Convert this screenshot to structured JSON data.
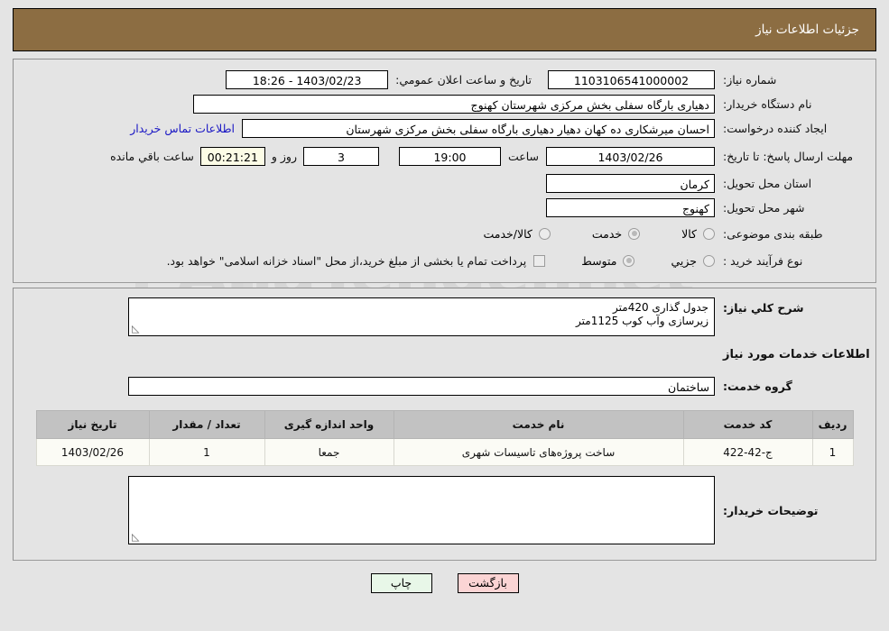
{
  "header": {
    "title": "جزئیات اطلاعات نیاز"
  },
  "colors": {
    "header_bg": "#8c6d42",
    "page_bg": "#e4e4e4",
    "link": "#1a17c4",
    "countdown_bg": "#fcfce6",
    "table_header_bg": "#c2c2c2",
    "back_button_bg": "#fbd4d4",
    "print_button_bg": "#e8f7e8"
  },
  "form": {
    "need_number_label": "شماره نیاز:",
    "need_number_value": "1103106541000002",
    "announce_label": "تاریخ و ساعت اعلان عمومي:",
    "announce_value": "1403/02/23 - 18:26",
    "buyer_org_label": "نام دستگاه خریدار:",
    "buyer_org_value": "دهیاری بارگاه سفلی بخش مرکزی شهرستان کهنوج",
    "creator_label": "ایجاد کننده درخواست:",
    "creator_value": "احسان میرشکاری ده کهان دهیار دهیاری بارگاه سفلی بخش مرکزی شهرستان",
    "contact_link": "اطلاعات تماس خریدار",
    "deadline_label": "مهلت ارسال پاسخ: تا تاریخ:",
    "deadline_date": "1403/02/26",
    "hour_label": "ساعت",
    "hour_value": "19:00",
    "days_value": "3",
    "days_label": "روز و",
    "countdown_value": "00:21:21",
    "remaining_label": "ساعت باقي مانده",
    "province_label": "استان محل تحویل:",
    "province_value": "کرمان",
    "city_label": "شهر محل تحویل:",
    "city_value": "کهنوج",
    "category_label": "طبقه بندی موضوعی:",
    "category_options": [
      {
        "label": "کالا",
        "selected": false
      },
      {
        "label": "خدمت",
        "selected": true
      },
      {
        "label": "کالا/خدمت",
        "selected": false
      }
    ],
    "process_label": "نوع فرآیند خرید :",
    "process_options": [
      {
        "label": "جزيي",
        "selected": false
      },
      {
        "label": "متوسط",
        "selected": true
      }
    ],
    "treasury_checkbox_checked": false,
    "treasury_note": "پرداخت تمام یا بخشی از مبلغ خرید،از محل \"اسناد خزانه اسلامی\" خواهد بود."
  },
  "details": {
    "summary_label": "شرح کلي نیاز:",
    "summary_value": "جدول گذاری 420متر\nزیرسازی وآب کوب 1125متر",
    "services_heading": "اطلاعات خدمات مورد نیاز",
    "service_group_label": "گروه خدمت:",
    "service_group_value": "ساختمان",
    "buyer_notes_label": "توضیحات خریدار:",
    "buyer_notes_value": ""
  },
  "table": {
    "columns": [
      "ردیف",
      "کد خدمت",
      "نام خدمت",
      "واحد اندازه گیری",
      "تعداد / مقدار",
      "تاریخ نیاز"
    ],
    "rows": [
      {
        "index": "1",
        "code": "ج-42-422",
        "name": "ساخت پروژه‌های تاسیسات شهری",
        "unit": "جمعا",
        "quantity": "1",
        "date": "1403/02/26"
      }
    ]
  },
  "buttons": {
    "print": "چاپ",
    "back": "بازگشت"
  },
  "watermark": {
    "text": "AnaTender.net"
  }
}
